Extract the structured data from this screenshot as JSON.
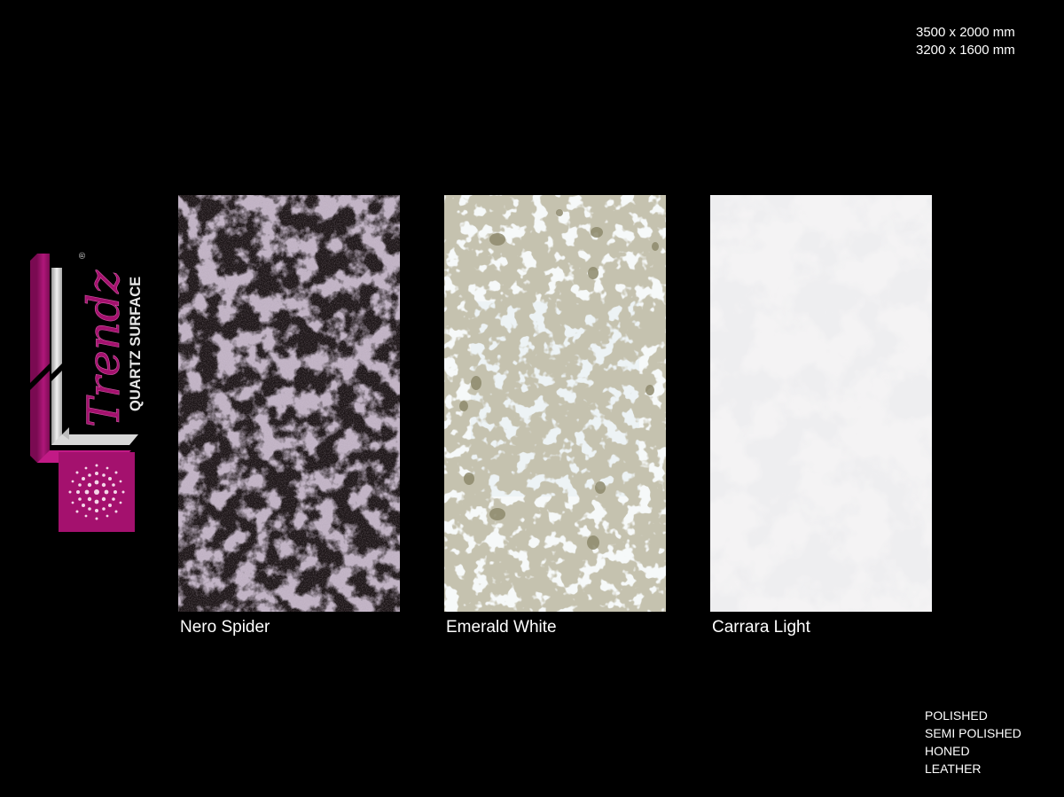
{
  "sizes": [
    "3500 x 2000 mm",
    "3200 x 1600 mm"
  ],
  "brand": {
    "name": "Trendz",
    "registered": "®",
    "tagline": "QUARTZ SURFACE",
    "accent": "#a4116e",
    "logo_icon": "concentric-dots-emblem"
  },
  "slabs": [
    {
      "name": "Nero Spider",
      "base_color": "#1a1416",
      "vein_color": "#b9a3c0"
    },
    {
      "name": "Emerald White",
      "base_color": "#f7fafa",
      "fleck_color": "#8e8a6d"
    },
    {
      "name": "Carrara Light",
      "base_color": "#f3f2f3",
      "vein_color": "#e2e1e3"
    }
  ],
  "finishes": [
    "POLISHED",
    "SEMI POLISHED",
    "HONED",
    "LEATHER"
  ]
}
